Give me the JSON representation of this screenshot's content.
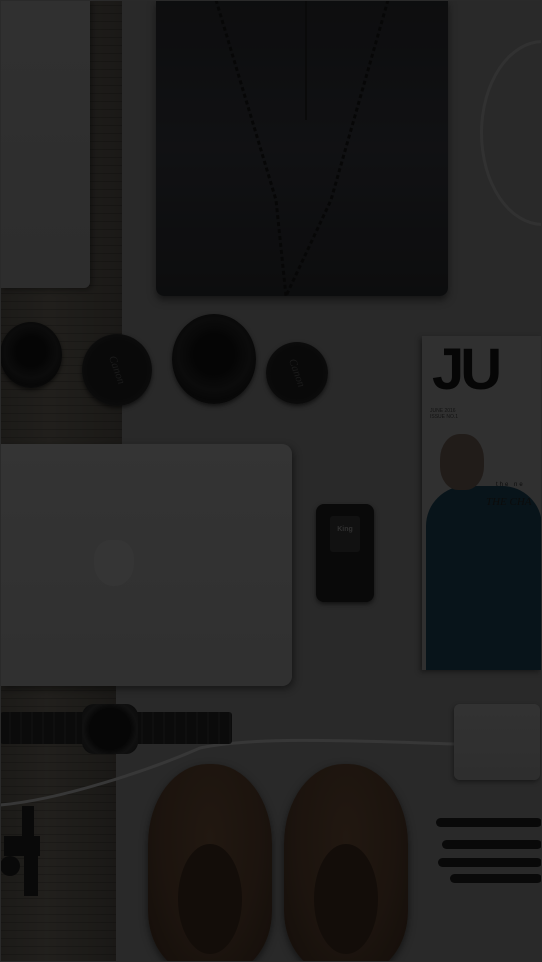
{
  "scene": {
    "alt": "Flat lay of clothing, camera lenses, laptop, magazine, watch, shoes and pens",
    "overlay_color": "#000000"
  },
  "lens_caps": {
    "cap1_label": "Canon",
    "cap2_label": "Canon"
  },
  "flash_trigger": {
    "label": "King"
  },
  "magazine": {
    "title": "JU",
    "subtitle": "JUNE 2016 ISSUE NO.1",
    "cover_small": "the ne",
    "cover_tagline": "THE CHA"
  }
}
